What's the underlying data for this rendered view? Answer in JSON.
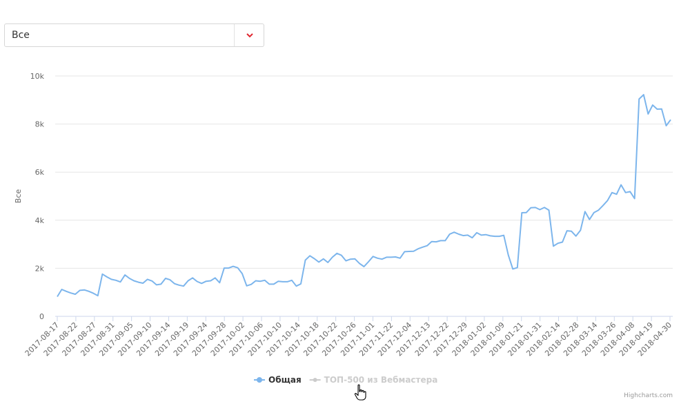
{
  "selector": {
    "value": "Все",
    "icon": "chevron-down-icon"
  },
  "credit": "Highcharts.com",
  "chart_data": {
    "type": "line",
    "ylabel": "Все",
    "ylim": [
      0,
      10000
    ],
    "yticks": [
      0,
      2000,
      4000,
      6000,
      8000,
      10000
    ],
    "ytick_labels": [
      "0",
      "2k",
      "4k",
      "6k",
      "8k",
      "10k"
    ],
    "xtick_labels": [
      "2017-08-17",
      "2017-08-22",
      "2017-08-27",
      "2017-08-31",
      "2017-09-05",
      "2017-09-10",
      "2017-09-14",
      "2017-09-19",
      "2017-09-24",
      "2017-09-28",
      "2017-10-02",
      "2017-10-06",
      "2017-10-10",
      "2017-10-14",
      "2017-10-18",
      "2017-10-22",
      "2017-10-26",
      "2017-11-01",
      "2017-11-22",
      "2017-12-04",
      "2017-12-13",
      "2017-12-22",
      "2017-12-29",
      "2018-01-02",
      "2018-01-09",
      "2018-01-21",
      "2018-01-31",
      "2018-02-14",
      "2018-02-28",
      "2018-03-14",
      "2018-03-26",
      "2018-04-08",
      "2018-04-19",
      "2018-04-30"
    ],
    "grid": true,
    "legend_position": "bottom-center",
    "series": [
      {
        "name": "Общая",
        "color": "#7cb5ec",
        "visible": true,
        "values": [
          820,
          1120,
          1040,
          970,
          920,
          1080,
          1100,
          1040,
          960,
          860,
          1760,
          1640,
          1540,
          1500,
          1430,
          1720,
          1580,
          1480,
          1420,
          1380,
          1540,
          1470,
          1310,
          1340,
          1580,
          1520,
          1360,
          1300,
          1260,
          1480,
          1600,
          1450,
          1370,
          1460,
          1480,
          1600,
          1400,
          2010,
          2010,
          2080,
          2020,
          1780,
          1270,
          1330,
          1480,
          1460,
          1500,
          1340,
          1340,
          1460,
          1440,
          1440,
          1500,
          1260,
          1350,
          2340,
          2520,
          2400,
          2260,
          2390,
          2240,
          2460,
          2620,
          2540,
          2310,
          2380,
          2390,
          2200,
          2070,
          2270,
          2490,
          2420,
          2380,
          2460,
          2460,
          2470,
          2420,
          2690,
          2700,
          2710,
          2810,
          2880,
          2940,
          3110,
          3100,
          3150,
          3150,
          3420,
          3500,
          3420,
          3360,
          3380,
          3270,
          3480,
          3380,
          3400,
          3350,
          3330,
          3330,
          3370,
          2550,
          1970,
          2030,
          4310,
          4320,
          4520,
          4530,
          4440,
          4530,
          4420,
          2920,
          3040,
          3090,
          3560,
          3540,
          3340,
          3580,
          4360,
          4030,
          4320,
          4420,
          4610,
          4820,
          5150,
          5080,
          5470,
          5150,
          5190,
          4900,
          9040,
          9220,
          8420,
          8790,
          8620,
          8630,
          7930,
          8180
        ]
      },
      {
        "name": "ТОП-500 из Вебмастера",
        "color": "#cccccc",
        "visible": false,
        "values": []
      }
    ]
  }
}
